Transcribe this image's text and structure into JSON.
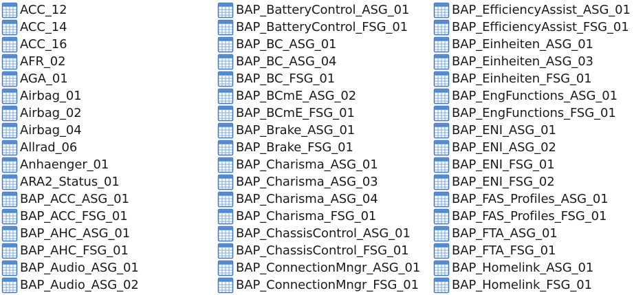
{
  "icon": "table-file-icon",
  "colors": {
    "icon_border": "#3d78c6",
    "icon_header": "#4f89d1",
    "icon_grid": "#7aa8e0",
    "icon_cell": "#ffffff",
    "text": "#1a1a1a"
  },
  "columns": [
    {
      "items": [
        "ACC_12",
        "ACC_14",
        "ACC_16",
        "AFR_02",
        "AGA_01",
        "Airbag_01",
        "Airbag_02",
        "Airbag_04",
        "Allrad_06",
        "Anhaenger_01",
        "ARA2_Status_01",
        "BAP_ACC_ASG_01",
        "BAP_ACC_FSG_01",
        "BAP_AHC_ASG_01",
        "BAP_AHC_FSG_01",
        "BAP_Audio_ASG_01",
        "BAP_Audio_ASG_02"
      ]
    },
    {
      "items": [
        "BAP_BatteryControl_ASG_01",
        "BAP_BatteryControl_FSG_01",
        "BAP_BC_ASG_01",
        "BAP_BC_ASG_04",
        "BAP_BC_FSG_01",
        "BAP_BCmE_ASG_02",
        "BAP_BCmE_FSG_01",
        "BAP_Brake_ASG_01",
        "BAP_Brake_FSG_01",
        "BAP_Charisma_ASG_01",
        "BAP_Charisma_ASG_03",
        "BAP_Charisma_ASG_04",
        "BAP_Charisma_FSG_01",
        "BAP_ChassisControl_ASG_01",
        "BAP_ChassisControl_FSG_01",
        "BAP_ConnectionMngr_ASG_01",
        "BAP_ConnectionMngr_FSG_01"
      ]
    },
    {
      "items": [
        "BAP_EfficiencyAssist_ASG_01",
        "BAP_EfficiencyAssist_FSG_01",
        "BAP_Einheiten_ASG_01",
        "BAP_Einheiten_ASG_03",
        "BAP_Einheiten_FSG_01",
        "BAP_EngFunctions_ASG_01",
        "BAP_EngFunctions_FSG_01",
        "BAP_ENI_ASG_01",
        "BAP_ENI_ASG_02",
        "BAP_ENI_FSG_01",
        "BAP_ENI_FSG_02",
        "BAP_FAS_Profiles_ASG_01",
        "BAP_FAS_Profiles_FSG_01",
        "BAP_FTA_ASG_01",
        "BAP_FTA_FSG_01",
        "BAP_Homelink_ASG_01",
        "BAP_Homelink_FSG_01"
      ]
    }
  ]
}
